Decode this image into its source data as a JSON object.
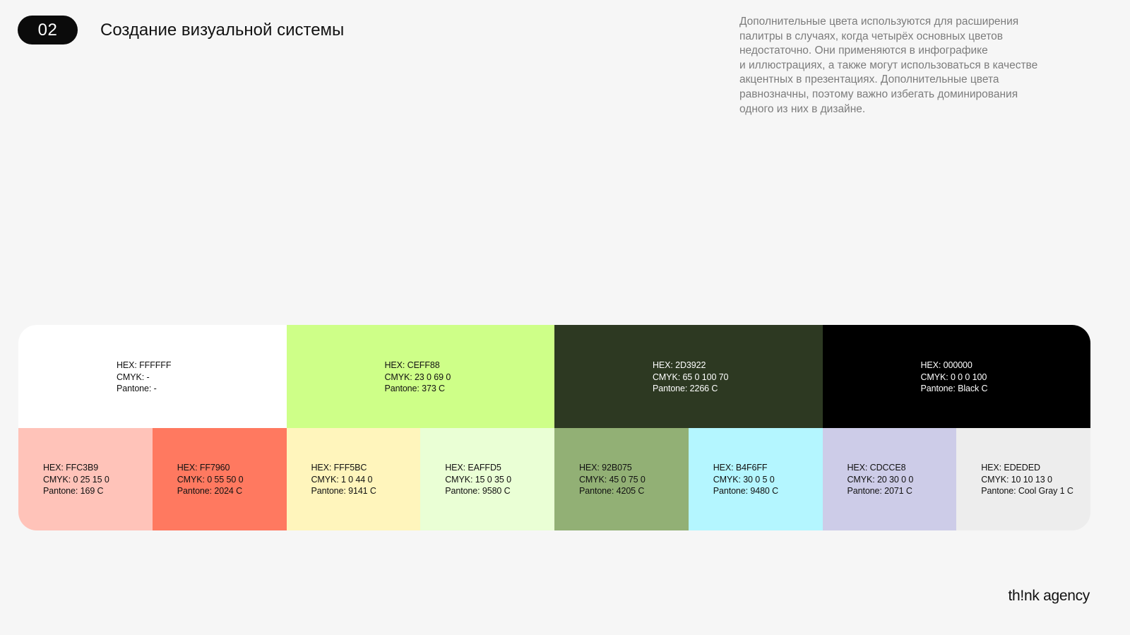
{
  "header": {
    "section_number": "02",
    "title": "Создание визуальной системы"
  },
  "description": {
    "lines": [
      "Дополнительные цвета используются для расширения",
      "палитры в случаях, когда четырёх основных цветов",
      "недостаточно. Они применяются в инфографике",
      "и иллюстрациях, а также могут использоваться в качестве",
      "акцентных в презентациях. Дополнительные цвета",
      "равнозначны, поэтому важно избегать доминирования",
      "одного из них в дизайне."
    ]
  },
  "palette": {
    "primary": [
      {
        "color": "#FFFFFF",
        "text_tone": "light",
        "hex": "HEX: FFFFFF",
        "cmyk": "CMYK: -",
        "pantone": "Pantone: -"
      },
      {
        "color": "#CEFF88",
        "text_tone": "light",
        "hex": "HEX: CEFF88",
        "cmyk": "CMYK: 23 0 69 0",
        "pantone": "Pantone: 373 C"
      },
      {
        "color": "#2D3922",
        "text_tone": "dark",
        "hex": "HEX: 2D3922",
        "cmyk": "CMYK: 65 0 100 70",
        "pantone": "Pantone: 2266 C"
      },
      {
        "color": "#000000",
        "text_tone": "dark",
        "hex": "HEX: 000000",
        "cmyk": "CMYK:  0 0 0 100",
        "pantone": "Pantone: Black C"
      }
    ],
    "secondary": [
      {
        "color": "#FFC3B9",
        "text_tone": "light",
        "hex": "HEX: FFC3B9",
        "cmyk": "CMYK: 0 25 15 0",
        "pantone": "Pantone: 169 C"
      },
      {
        "color": "#FF7960",
        "text_tone": "light",
        "hex": "HEX: FF7960",
        "cmyk": "CMYK: 0 55 50 0",
        "pantone": "Pantone: 2024 C"
      },
      {
        "color": "#FFF5BC",
        "text_tone": "light",
        "hex": "HEX: FFF5BC",
        "cmyk": "CMYK: 1 0 44 0",
        "pantone": "Pantone: 9141 C"
      },
      {
        "color": "#EAFFD5",
        "text_tone": "light",
        "hex": "HEX: EAFFD5",
        "cmyk": "CMYK: 15 0 35 0",
        "pantone": "Pantone: 9580 C"
      },
      {
        "color": "#92B075",
        "text_tone": "light",
        "hex": "HEX: 92B075",
        "cmyk": "CMYK: 45 0 75 0",
        "pantone": "Pantone: 4205 C"
      },
      {
        "color": "#B4F6FF",
        "text_tone": "light",
        "hex": "HEX: B4F6FF",
        "cmyk": "CMYK: 30 0 5 0",
        "pantone": "Pantone: 9480 C"
      },
      {
        "color": "#CDCCE8",
        "text_tone": "light",
        "hex": "HEX: CDCCE8",
        "cmyk": "CMYK: 20 30 0 0",
        "pantone": "Pantone: 2071 C"
      },
      {
        "color": "#EDEDED",
        "text_tone": "light",
        "hex": "HEX: EDEDED",
        "cmyk": "CMYK: 10 10 13 0",
        "pantone": "Pantone: Cool Gray 1 C"
      }
    ]
  },
  "footer": {
    "brand": "th!nk agency"
  }
}
